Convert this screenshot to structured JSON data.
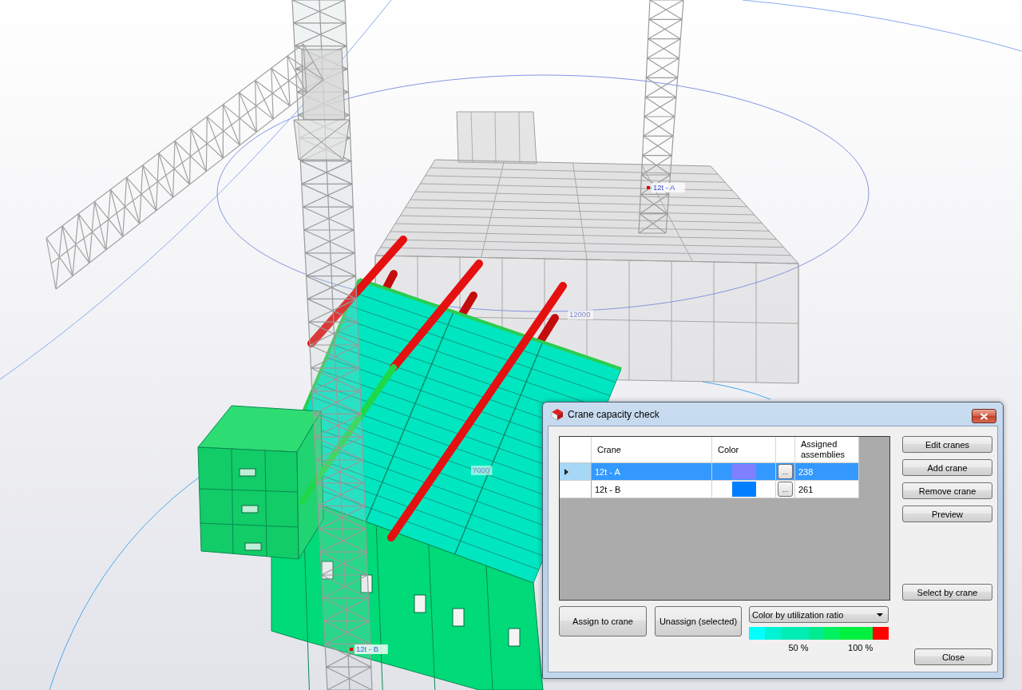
{
  "viewport": {
    "labels": [
      {
        "kind": "crane",
        "text": "12t - A"
      },
      {
        "kind": "dimension",
        "text": "12000"
      },
      {
        "kind": "dimension",
        "text": "7000"
      },
      {
        "kind": "crane",
        "text": "12t - B"
      }
    ]
  },
  "dialog": {
    "title": "Crane capacity check",
    "grid": {
      "columns": [
        {
          "label": "Crane"
        },
        {
          "label": "Color"
        },
        {
          "label": "Assigned assemblies"
        }
      ],
      "rows": [
        {
          "crane": "12t - A",
          "color": "#8080ff",
          "browse": "...",
          "assigned": "238",
          "selected": true
        },
        {
          "crane": "12t - B",
          "color": "#0080ff",
          "browse": "...",
          "assigned": "261",
          "selected": false
        }
      ]
    },
    "side_buttons": [
      "Edit cranes",
      "Add crane",
      "Remove crane",
      "Preview"
    ],
    "select_button": "Select by crane",
    "assign_button": "Assign to crane",
    "unassign_button": "Unassign (selected)",
    "color_mode": {
      "value": "Color by utilization ratio"
    },
    "legend": [
      {
        "color": "#00ffff"
      },
      {
        "color": "#00f2d4"
      },
      {
        "color": "#00ecb4",
        "label": "50 %"
      },
      {
        "color": "#00ea90"
      },
      {
        "color": "#00f060"
      },
      {
        "color": "#00f040",
        "label": "100 %"
      },
      {
        "color": "#ff0000"
      }
    ],
    "close_button": "Close"
  }
}
